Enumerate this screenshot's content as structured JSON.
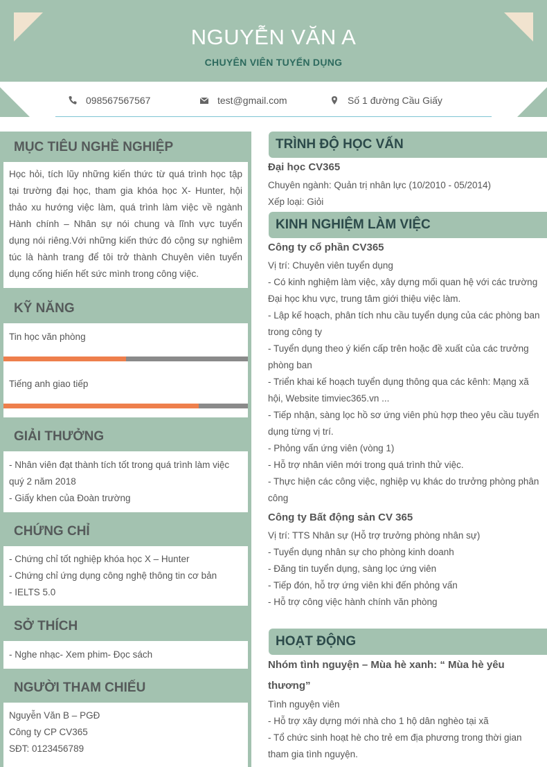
{
  "header": {
    "name": "NGUYỄN VĂN A",
    "title": "CHUYÊN VIÊN TUYỂN DỤNG"
  },
  "contact": {
    "phone": "098567567567",
    "email": "test@gmail.com",
    "address": "Số 1 đường Cầu Giấy"
  },
  "objective": {
    "heading": "MỤC TIÊU NGHỀ NGHIỆP",
    "text": "Học hỏi, tích lũy những kiến thức từ quá trình học tập tại trường đại học, tham gia khóa học X- Hunter, hội thảo xu hướng việc làm, quá trình làm việc về ngành Hành chính – Nhân sự nói chung và lĩnh vực tuyển dụng nói riêng.Với những kiến thức đó cộng sự nghiêm túc là hành trang để tôi trở thành Chuyên viên tuyển dụng cống hiến hết sức mình trong công việc."
  },
  "skills": {
    "heading": "KỸ NĂNG",
    "items": [
      {
        "name": "Tin học văn phòng",
        "level": 0.5
      },
      {
        "name": "Tiếng anh giao tiếp",
        "level": 0.8
      }
    ]
  },
  "awards": {
    "heading": "GIẢI THƯỞNG",
    "lines": [
      "- Nhân viên đạt thành tích tốt trong quá trình làm việc quý 2 năm 2018",
      "- Giấy khen của Đoàn trường"
    ]
  },
  "certificates": {
    "heading": "CHỨNG CHỈ",
    "lines": [
      "- Chứng chỉ tốt nghiệp khóa học X – Hunter",
      "- Chứng chỉ ứng dụng công nghệ thông tin cơ bản",
      "- IELTS 5.0"
    ]
  },
  "hobbies": {
    "heading": "SỞ THÍCH",
    "text": "- Nghe nhạc- Xem phim- Đọc sách"
  },
  "references": {
    "heading": "NGƯỜI THAM CHIẾU",
    "lines": [
      "Nguyễn Văn B – PGĐ",
      "Công ty CP CV365",
      "SĐT: 0123456789"
    ]
  },
  "education": {
    "heading": "TRÌNH ĐỘ HỌC VẤN",
    "school": "Đại học CV365",
    "major": "Chuyên ngành: Quản trị nhân lực (10/2010 - 05/2014)",
    "rank": "Xếp loại: Giỏi"
  },
  "experience": {
    "heading": "KINH NGHIỆM LÀM VIỆC",
    "jobs": [
      {
        "company": "Công ty cổ phần CV365",
        "lines": [
          "Vị trí: Chuyên viên tuyển dụng",
          "- Có kinh nghiệm làm việc, xây dựng mối quan hệ với các trường Đại học khu vực, trung tâm giới thiệu việc làm.",
          "- Lập kế hoạch, phân tích nhu cầu tuyển dụng của các phòng ban trong công ty",
          "- Tuyển dụng theo ý kiến cấp trên hoặc đề xuất của các trưởng phòng ban",
          "- Triển khai kế hoạch tuyển dụng thông qua các kênh: Mạng xã hội, Website timviec365.vn ...",
          "- Tiếp nhận, sàng lọc hồ sơ ứng viên phù hợp theo yêu cầu tuyển dụng từng vị trí.",
          "- Phỏng vấn ứng viên (vòng 1)",
          "- Hỗ trợ nhân viên mới trong quá trình thử việc.",
          "- Thực hiện các công việc, nghiệp vụ khác do trưởng phòng phân công"
        ]
      },
      {
        "company": "Công ty Bất động sản CV 365",
        "lines": [
          "Vị trí: TTS Nhân sự (Hỗ trợ trưởng phòng nhân sự)",
          "- Tuyển dụng nhân sự cho phòng kinh doanh",
          "- Đăng tin tuyển dụng, sàng lọc ứng viên",
          "- Tiếp đón, hỗ trợ ứng viên khi đến phỏng vấn",
          "- Hỗ trợ công việc hành chính văn phòng"
        ]
      }
    ]
  },
  "activities": {
    "heading": "HOẠT ĐỘNG",
    "org": "Nhóm tình nguyện – Mùa hè xanh: “ Mùa hè yêu thương”",
    "lines": [
      "Tình nguyện viên",
      "- Hỗ trợ xây dựng mới nhà cho 1 hộ dân nghèo tại xã",
      "- Tổ chức sinh hoạt hè cho trẻ em địa phương trong thời gian tham gia tình nguyện."
    ]
  },
  "icons": [
    "phone-icon",
    "mail-icon",
    "location-icon"
  ],
  "colors": {
    "sage": "#a3c2b0",
    "cream": "#f1e3cf",
    "orange": "#ee7f4c",
    "teal": "#2d6a5e"
  }
}
